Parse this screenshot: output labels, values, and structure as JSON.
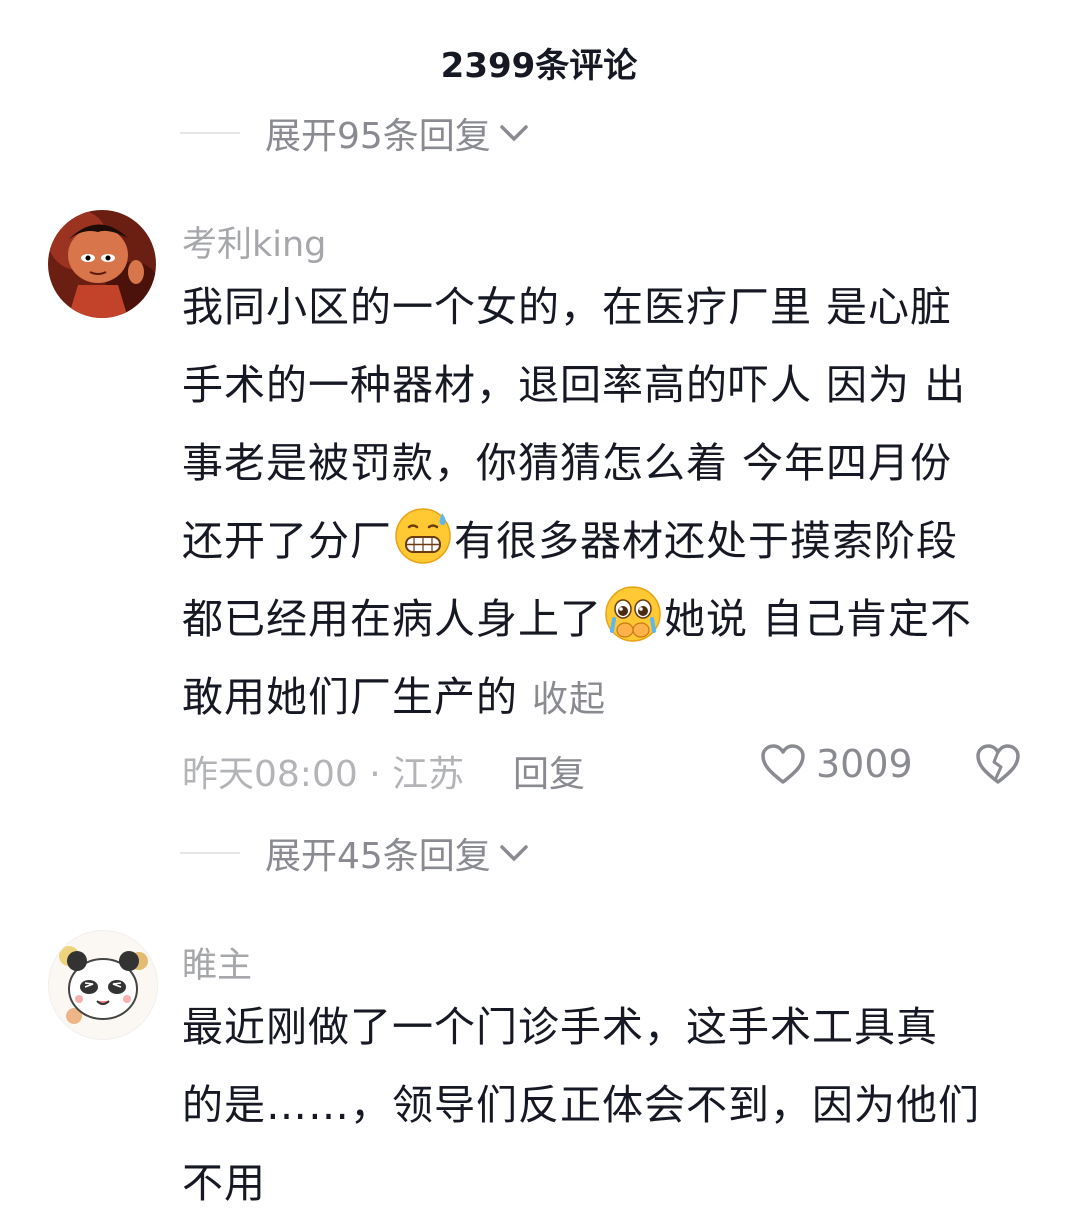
{
  "header": {
    "comment_count": "2399条评论"
  },
  "expand_replies_1": {
    "label": "展开95条回复"
  },
  "comment_1": {
    "username": "考利king",
    "lines": [
      "我同小区的一个女的，在医疗厂里  是心脏",
      "手术的一种器材，退回率高的吓人  因为 出",
      "事老是被罚款，你猜猜怎么着 今年四月份"
    ],
    "line4_a": "还开了分厂",
    "line4_b": "有很多器材还处于摸索阶段",
    "line5_a": "都已经用在病人身上了",
    "line5_b": "她说 自己肯定不",
    "line6": "敢用她们厂生产的",
    "collapse_label": "收起",
    "emoji_1": "grimace-sweat-emoji",
    "emoji_2": "teary-face-emoji",
    "time_location": "昨天08:00 · 江苏",
    "reply_label": "回复",
    "like_count": "3009"
  },
  "expand_replies_2": {
    "label": "展开45条回复"
  },
  "comment_2": {
    "username": "睢主",
    "lines": [
      "最近刚做了一个门诊手术，这手术工具真",
      "的是……，领导们反正体会不到，因为他们",
      "不用"
    ]
  },
  "colors": {
    "text_primary": "#161823",
    "text_secondary": "#8a8b91",
    "text_muted": "#a6a7ab"
  }
}
